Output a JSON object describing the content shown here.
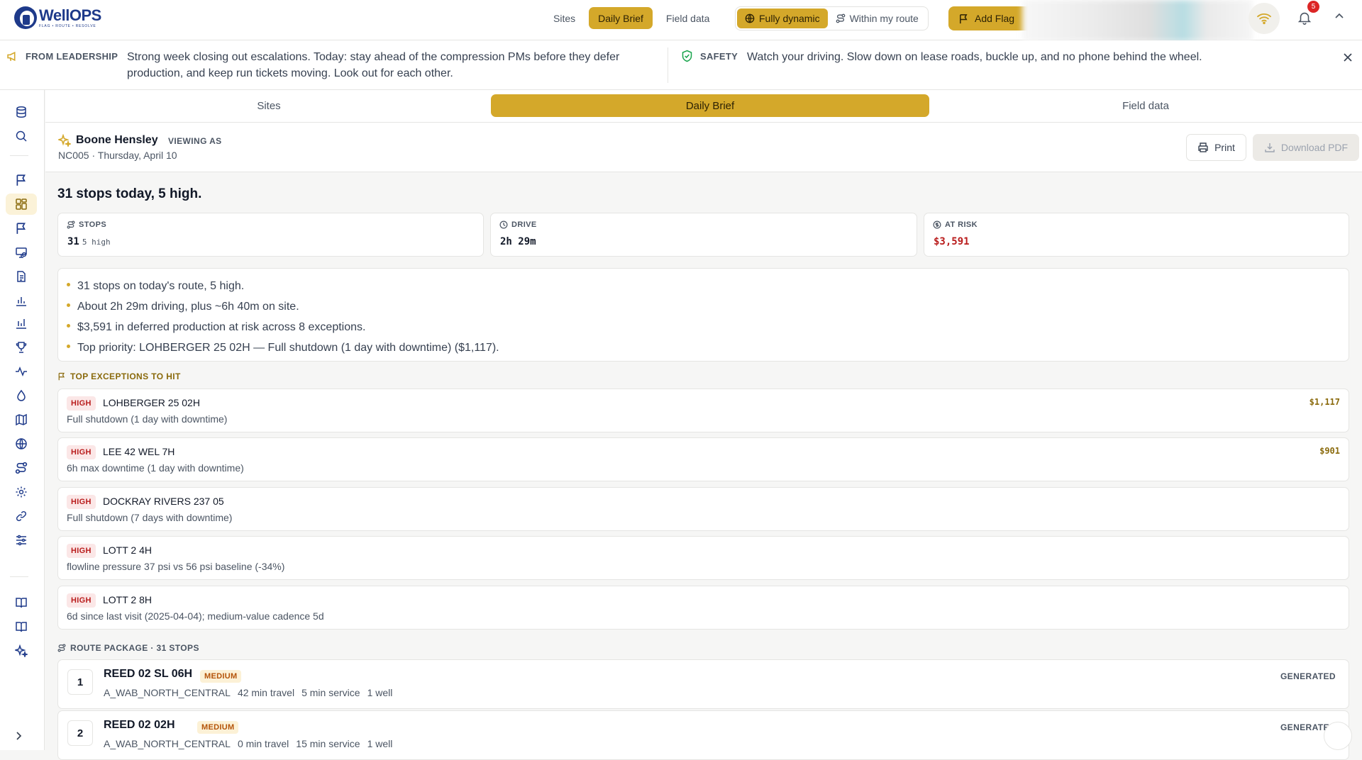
{
  "app": {
    "logo_title": "WellOPS",
    "logo_tagline": "FLAG • ROUTE • RESOLVE",
    "nav": [
      {
        "label": "Sites",
        "active": false
      },
      {
        "label": "Daily Brief",
        "active": true
      },
      {
        "label": "Field data",
        "active": false
      }
    ],
    "route_mode": [
      {
        "label": "Fully dynamic",
        "active": true
      },
      {
        "label": "Within my route",
        "active": false
      }
    ],
    "add_flag_label": "Add Flag",
    "notification_count": "5"
  },
  "banner": {
    "leadership_label": "FROM LEADERSHIP",
    "leadership_text": "Strong week closing out escalations. Today: stay ahead of the compression PMs before they defer production, and keep run tickets moving. Look out for each other.",
    "safety_label": "SAFETY",
    "safety_text": "Watch your driving. Slow down on lease roads, buckle up, and no phone behind the wheel."
  },
  "subtabs": [
    {
      "label": "Sites",
      "active": false
    },
    {
      "label": "Daily Brief",
      "active": true
    },
    {
      "label": "Field data",
      "active": false
    }
  ],
  "viewer": {
    "name": "Boone Hensley",
    "viewing_as": "VIEWING AS",
    "route_and_date": "NC005 · Thursday, April 10",
    "print_label": "Print",
    "download_label": "Download PDF"
  },
  "brief": {
    "headline": "31 stops today, 5 high.",
    "kpis": [
      {
        "label": "STOPS",
        "value": "31",
        "sub": "5 high",
        "icon": "route-icon"
      },
      {
        "label": "DRIVE",
        "value": "2h 29m",
        "sub": "",
        "icon": "clock-icon"
      },
      {
        "label": "AT RISK",
        "value": "$3,591",
        "sub": "",
        "icon": "dollar-circle-icon",
        "color": "#b91c1c"
      }
    ],
    "summary": [
      "31 stops on today's route, 5 high.",
      "About 2h 29m driving, plus ~6h 40m on site.",
      "$3,591 in deferred production at risk across 8 exceptions.",
      "Top priority: LOHBERGER 25 02H — Full shutdown (1 day with downtime) ($1,117)."
    ],
    "exceptions_label": "TOP EXCEPTIONS TO HIT",
    "exceptions": [
      {
        "priority": "HIGH",
        "name": "LOHBERGER 25 02H",
        "desc": "Full shutdown (1 day with downtime)",
        "amount": "$1,117"
      },
      {
        "priority": "HIGH",
        "name": "LEE 42 WEL 7H",
        "desc": "6h max downtime (1 day with downtime)",
        "amount": "$901"
      },
      {
        "priority": "HIGH",
        "name": "DOCKRAY RIVERS 237 05",
        "desc": "Full shutdown (7 days with downtime)",
        "amount": ""
      },
      {
        "priority": "HIGH",
        "name": "LOTT 2 4H",
        "desc": "flowline pressure 37 psi vs 56 psi baseline (-34%)",
        "amount": ""
      },
      {
        "priority": "HIGH",
        "name": "LOTT 2 8H",
        "desc": "6d since last visit (2025-04-04); medium-value cadence 5d",
        "amount": ""
      }
    ],
    "route_label": "ROUTE PACKAGE · 31 STOPS",
    "stops": [
      {
        "num": "1",
        "name": "REED 02 SL 06H",
        "priority": "MEDIUM",
        "area": "A_WAB_NORTH_CENTRAL",
        "travel": "42 min travel",
        "service": "5 min service",
        "wells": "1 well",
        "status": "GENERATED"
      },
      {
        "num": "2",
        "name": "REED 02 02H",
        "priority": "MEDIUM",
        "area": "A_WAB_NORTH_CENTRAL",
        "travel": "0 min travel",
        "service": "15 min service",
        "wells": "1 well",
        "status": "GENERATED"
      }
    ]
  },
  "colors": {
    "accent": "#d4a82a",
    "high": "#b91c1c",
    "medium": "#b45309"
  }
}
